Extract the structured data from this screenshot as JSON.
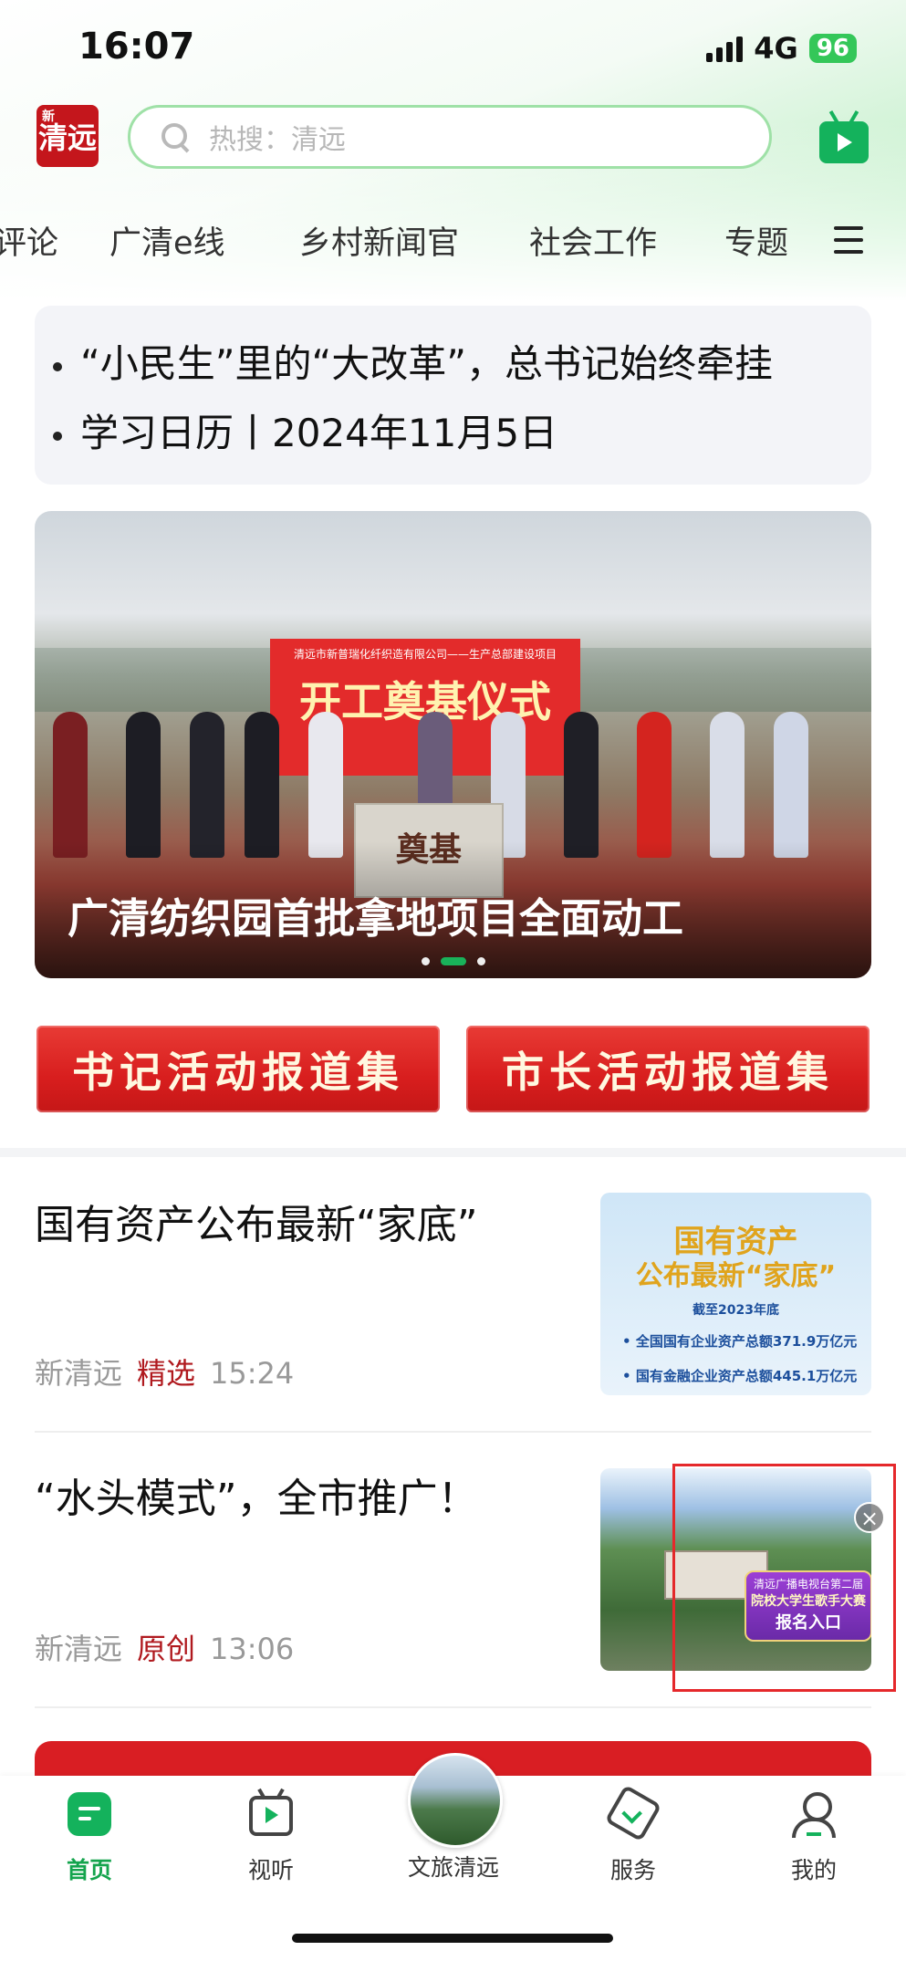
{
  "status_bar": {
    "time": "16:07",
    "network": "4G",
    "battery": "96"
  },
  "header": {
    "logo_text": "清远",
    "logo_prefix": "新",
    "search_placeholder": "热搜：清远"
  },
  "tabs": [
    "评论",
    "广清e线",
    "乡村新闻官",
    "社会工作",
    "专题"
  ],
  "ticker": {
    "items": [
      "“小民生”里的“大改革”，总书记始终牵挂",
      "学习日历丨2024年11月5日"
    ]
  },
  "banner": {
    "caption": "广清纺织园首批拿地项目全面动工",
    "board_subtitle": "清远市新普瑞化纤织造有限公司——生产总部建设项目",
    "board_title": "开工奠基仪式",
    "stone_text": "奠基",
    "active_index": 1,
    "count": 3
  },
  "report_buttons": [
    "书记活动报道集",
    "市长活动报道集"
  ],
  "news": [
    {
      "title": "国有资产公布最新“家底”",
      "source": "新清远",
      "tag": "精选",
      "time": "15:24",
      "thumb": {
        "line1": "国有资产",
        "line2": "公布最新“家底”",
        "line3": "截至2023年底",
        "bullet1": "全国国有企业资产总额371.9万亿元",
        "bullet2": "国有金融企业资产总额445.1万亿元"
      }
    },
    {
      "title": "“水头模式”，全市推广！",
      "source": "新清远",
      "tag": "原创",
      "time": "13:06",
      "thumb": {
        "badge_line1": "清远广播电视台第二届",
        "badge_line2": "院校大学生歌手大赛",
        "badge_line3": "报名入口",
        "close": "×"
      }
    }
  ],
  "bottom_nav": {
    "items": [
      "首页",
      "视听",
      "文旅清远",
      "服务",
      "我的"
    ],
    "active": "首页"
  },
  "colors": {
    "brand_green": "#14b25c",
    "brand_red": "#d91e23",
    "tag_red": "#b0191e"
  }
}
